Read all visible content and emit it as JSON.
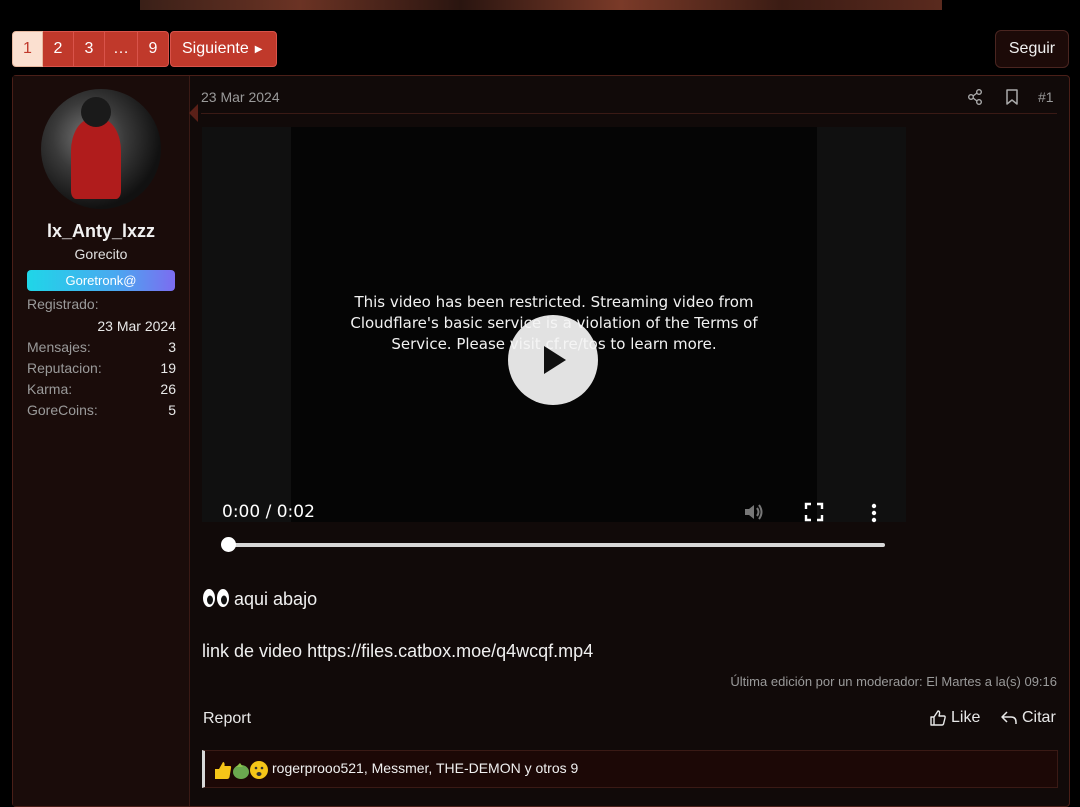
{
  "pagination": {
    "pages": [
      "1",
      "2",
      "3",
      "…",
      "9"
    ],
    "active_page": "1",
    "next_label": "Siguiente",
    "follow_label": "Seguir"
  },
  "author": {
    "username": "lx_Anty_lxzz",
    "user_title": "Gorecito",
    "banner": "Goretronk@",
    "registered_label": "Registrado:",
    "registered_value": "23 Mar 2024",
    "stats": [
      {
        "label": "Mensajes:",
        "value": "3"
      },
      {
        "label": "Reputacion:",
        "value": "19"
      },
      {
        "label": "Karma:",
        "value": "26"
      },
      {
        "label": "GoreCoins:",
        "value": "5"
      }
    ]
  },
  "post": {
    "date": "23 Mar 2024",
    "number": "#1",
    "video": {
      "restricted_message": "This video has been restricted. Streaming video from Cloudflare's basic service is a violation of the Terms of Service. Please visit cf.re/tos to learn more.",
      "time": "0:00 / 0:02",
      "progress": 0
    },
    "line1": "aqui abajo",
    "line2": "link de video https://files.catbox.moe/q4wcqf.mp4",
    "edited_note": "Última edición por un moderador: El Martes a la(s) 09:16",
    "report_label": "Report",
    "like_label": "Like",
    "quote_label": "Citar",
    "reactions_text": "rogerprooo521, Messmer, THE-DEMON y otros 9"
  },
  "colors": {
    "accent": "#c0392b",
    "active_page_bg": "#fbe0d0",
    "badge_gradient_start": "#1fd6e8",
    "badge_gradient_end": "#7c6cf0"
  }
}
